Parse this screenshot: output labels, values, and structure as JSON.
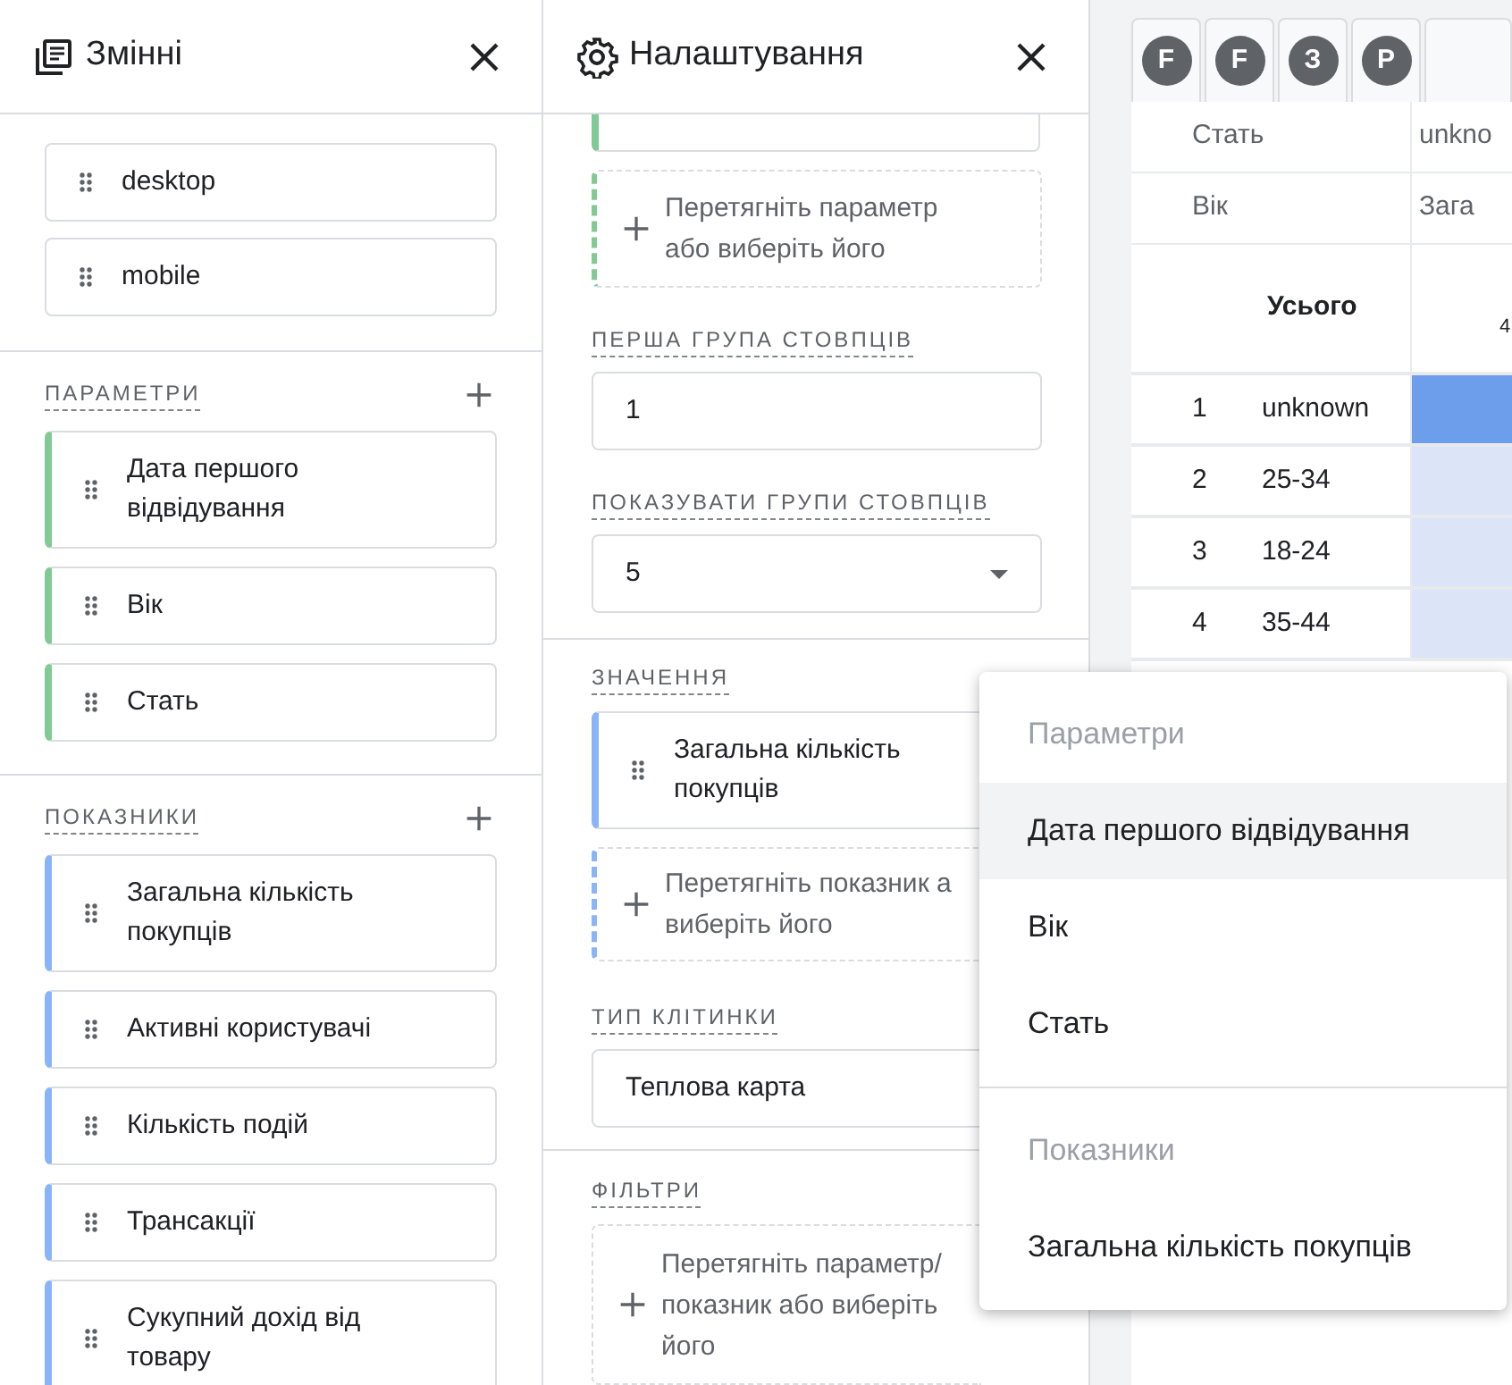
{
  "variables_panel": {
    "title": "Змінні",
    "segments": [
      "desktop",
      "mobile"
    ],
    "sections": [
      {
        "title": "ПАРАМЕТРИ",
        "kind": "dimension",
        "items": [
          {
            "lines": [
              "Дата першого",
              "відвідування"
            ]
          },
          {
            "lines": [
              "Вік"
            ]
          },
          {
            "lines": [
              "Стать"
            ]
          }
        ]
      },
      {
        "title": "ПОКАЗНИКИ",
        "kind": "metric",
        "items": [
          {
            "lines": [
              "Загальна кількість",
              "покупців"
            ]
          },
          {
            "lines": [
              "Активні користувачі"
            ]
          },
          {
            "lines": [
              "Кількість подій"
            ]
          },
          {
            "lines": [
              "Трансакції"
            ]
          },
          {
            "lines": [
              "Сукупний дохід від",
              "товару"
            ]
          }
        ]
      }
    ]
  },
  "settings_panel": {
    "title": "Налаштування",
    "rows_card": {
      "kind": "dimension"
    },
    "rows_drop": {
      "kind": "dimension",
      "lines": [
        "Перетягніть параметр",
        "або виберіть його"
      ]
    },
    "first_column_group": {
      "label": "ПЕРША ГРУПА СТОВПЦІВ",
      "value": "1"
    },
    "show_column_groups": {
      "label": "ПОКАЗУВАТИ ГРУПИ СТОВПЦІВ",
      "value": "5"
    },
    "values": {
      "label": "ЗНАЧЕННЯ",
      "card": {
        "kind": "metric",
        "lines": [
          "Загальна кількість",
          "покупців"
        ]
      },
      "drop": {
        "kind": "metric",
        "lines": [
          "Перетягніть показник а",
          "виберіть його"
        ]
      }
    },
    "cell_type": {
      "label": "ТИП КЛІТИНКИ",
      "value": "Теплова карта"
    },
    "filters": {
      "label": "ФІЛЬТРИ",
      "drop": {
        "lines": [
          "Перетягніть параметр/",
          "показник або виберіть",
          "його"
        ]
      }
    }
  },
  "tabs": [
    {
      "letter": "F"
    },
    {
      "letter": "F"
    },
    {
      "letter": "З"
    },
    {
      "letter": "P"
    }
  ],
  "table": {
    "header_rows": [
      {
        "label": "Стать",
        "value": "unkno"
      },
      {
        "label": "Вік",
        "value": "Зага"
      }
    ],
    "total": {
      "label": "Усього",
      "value": "4"
    },
    "rows": [
      {
        "index": "1",
        "label": "unknown",
        "color": "#6d9eeb"
      },
      {
        "index": "2",
        "label": "25-34",
        "color": "#dbe5f7"
      },
      {
        "index": "3",
        "label": "18-24",
        "color": "#dbe5f7"
      },
      {
        "index": "4",
        "label": "35-44",
        "color": "#dbe5f7"
      }
    ]
  },
  "menu": {
    "groups": [
      {
        "heading": "Параметри",
        "items": [
          {
            "label": "Дата першого відвідування",
            "highlighted": true
          },
          {
            "label": "Вік",
            "highlighted": false
          },
          {
            "label": "Стать",
            "highlighted": false
          }
        ]
      },
      {
        "heading": "Показники",
        "items": [
          {
            "label": "Загальна кількість покупців",
            "highlighted": false
          }
        ]
      }
    ]
  }
}
